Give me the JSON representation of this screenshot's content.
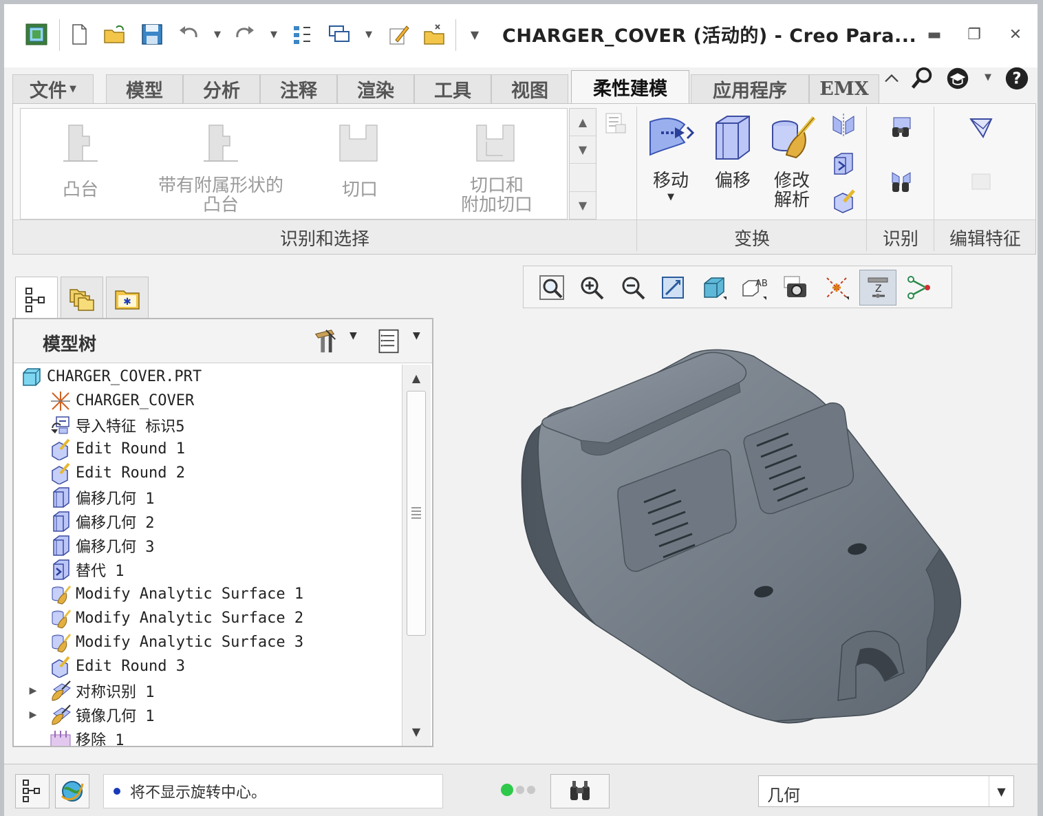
{
  "window": {
    "title": "CHARGER_COVER (活动的) - Creo Para..."
  },
  "tabs": [
    {
      "label": "文件"
    },
    {
      "label": "模型"
    },
    {
      "label": "分析"
    },
    {
      "label": "注释"
    },
    {
      "label": "渲染"
    },
    {
      "label": "工具"
    },
    {
      "label": "视图"
    },
    {
      "label": "柔性建模",
      "active": true
    },
    {
      "label": "应用程序"
    },
    {
      "label": "EMX"
    }
  ],
  "ribbon": {
    "gallery_items": [
      {
        "label_1": "凸台",
        "label_2": ""
      },
      {
        "label_1": "带有附属形状的",
        "label_2": "凸台"
      },
      {
        "label_1": "切口",
        "label_2": ""
      },
      {
        "label_1": "切口和",
        "label_2": "附加切口"
      }
    ],
    "groups": {
      "identify_select": "识别和选择",
      "transform": "变换",
      "recognize": "识别",
      "edit_features": "编辑特征"
    },
    "transform": {
      "move": "移动",
      "offset": "偏移",
      "modify_line1": "修改",
      "modify_line2": "解析"
    }
  },
  "model_tree": {
    "title": "模型树",
    "items": [
      {
        "text": "CHARGER_COVER.PRT",
        "icon": "part-icon"
      },
      {
        "text": "CHARGER_COVER",
        "icon": "coordinate-system-icon"
      },
      {
        "text": "导入特征 标识5",
        "icon": "import-feature-icon"
      },
      {
        "text": "Edit Round 1",
        "icon": "edit-round-icon"
      },
      {
        "text": "Edit Round 2",
        "icon": "edit-round-icon"
      },
      {
        "text": "偏移几何 1",
        "icon": "offset-geometry-icon"
      },
      {
        "text": "偏移几何 2",
        "icon": "offset-geometry-icon"
      },
      {
        "text": "偏移几何 3",
        "icon": "offset-geometry-icon"
      },
      {
        "text": "替代 1",
        "icon": "substitute-icon"
      },
      {
        "text": "Modify Analytic Surface 1",
        "icon": "modify-analytic-icon"
      },
      {
        "text": "Modify Analytic Surface 2",
        "icon": "modify-analytic-icon"
      },
      {
        "text": "Modify Analytic Surface 3",
        "icon": "modify-analytic-icon"
      },
      {
        "text": "Edit Round 3",
        "icon": "edit-round-icon"
      },
      {
        "text": "对称识别 1",
        "icon": "symmetry-recognition-icon",
        "expandable": true
      },
      {
        "text": "镜像几何 1",
        "icon": "mirror-geometry-icon",
        "expandable": true
      },
      {
        "text": "移除 1",
        "icon": "remove-icon"
      }
    ]
  },
  "status": {
    "message": "将不显示旋转中心。",
    "filter_value": "几何"
  },
  "colors": {
    "model_surface": "#6b737c",
    "accent_blue": "#1a3bb8",
    "tab_active_bg": "#f7f7f7"
  }
}
